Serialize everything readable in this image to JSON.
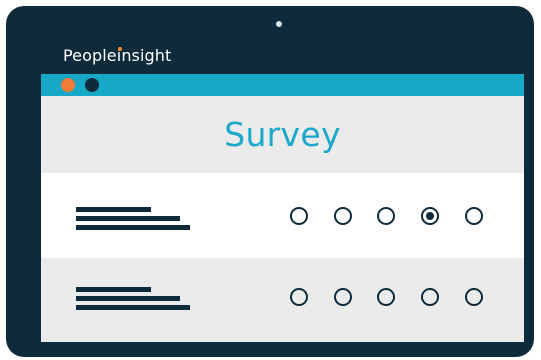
{
  "brand": {
    "name_prefix": "People",
    "name_i": "i",
    "name_suffix": "nsight"
  },
  "window": {
    "dots": [
      "orange",
      "navy"
    ],
    "colors": {
      "accent": "#16a8c6",
      "orange": "#f27b35",
      "navy": "#0e2b3c"
    }
  },
  "survey": {
    "title": "Survey",
    "questions": [
      {
        "options": 5,
        "selected_option": 4
      },
      {
        "options": 5,
        "selected_option": null
      }
    ]
  }
}
